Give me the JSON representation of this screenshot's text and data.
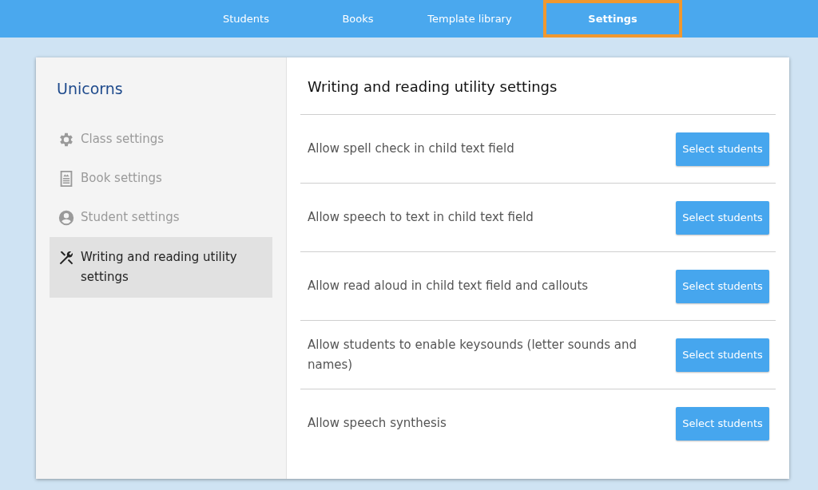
{
  "nav": {
    "tabs": [
      {
        "label": "Students",
        "selected": false
      },
      {
        "label": "Books",
        "selected": false
      },
      {
        "label": "Template library",
        "selected": false
      },
      {
        "label": "Settings",
        "selected": true
      }
    ]
  },
  "sidebar": {
    "title": "Unicorns",
    "items": [
      {
        "label": "Class settings",
        "kind": "gear",
        "selected": false
      },
      {
        "label": "Book settings",
        "kind": "book",
        "selected": false
      },
      {
        "label": "Student settings",
        "kind": "person",
        "selected": false
      },
      {
        "label": "Writing and reading utility settings",
        "kind": "tools",
        "selected": true
      }
    ]
  },
  "main": {
    "title": "Writing and reading utility settings",
    "rows": [
      {
        "label": "Allow spell check in child text field",
        "button": "Select students"
      },
      {
        "label": "Allow speech to text in child text field",
        "button": "Select students"
      },
      {
        "label": "Allow read aloud in child text field and callouts",
        "button": "Select students"
      },
      {
        "label": "Allow students to enable keysounds (letter sounds and names)",
        "button": "Select students"
      },
      {
        "label": "Allow speech synthesis",
        "button": "Select students"
      }
    ]
  }
}
